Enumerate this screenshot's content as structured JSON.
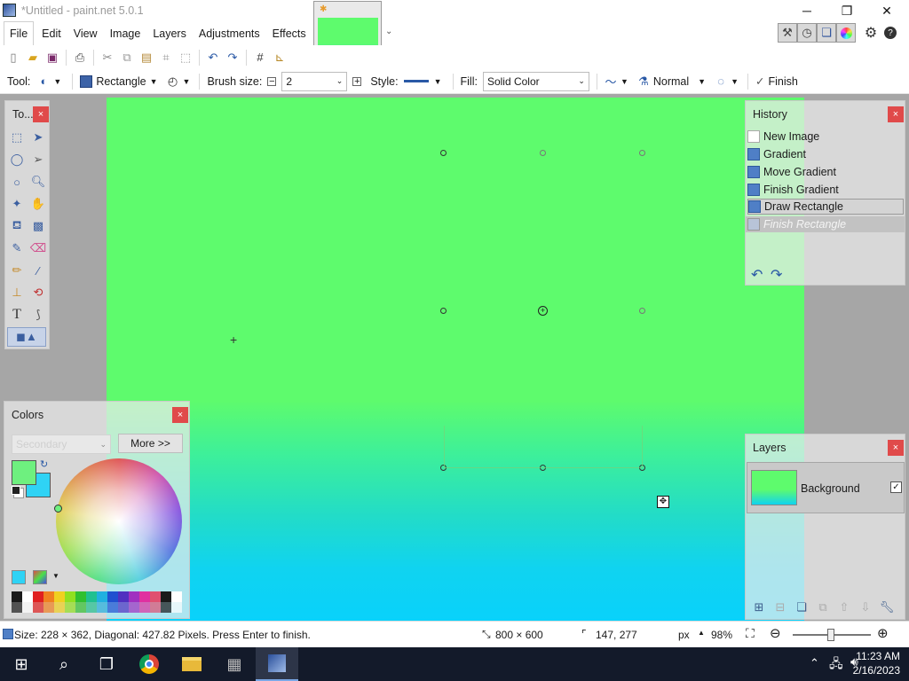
{
  "window": {
    "title": "*Untitled - paint.net 5.0.1",
    "minimize": "─",
    "restore": "❐",
    "close": "✕"
  },
  "menu": {
    "items": [
      "File",
      "Edit",
      "View",
      "Image",
      "Layers",
      "Adjustments",
      "Effects"
    ]
  },
  "image_tab": {
    "dirty_marker": "✱"
  },
  "toolbar": {
    "tool_label": "Tool:",
    "shape_type": "Rectangle",
    "brush_label": "Brush size:",
    "brush_value": "2",
    "style_label": "Style:",
    "fill_label": "Fill:",
    "fill_value": "Solid Color",
    "blend_value": "Normal",
    "finish_label": "Finish"
  },
  "tools_panel": {
    "title": "To..."
  },
  "history_panel": {
    "title": "History",
    "items": [
      "New Image",
      "Gradient",
      "Move Gradient",
      "Finish Gradient",
      "Draw Rectangle",
      "Finish Rectangle"
    ],
    "selected_index": 4
  },
  "colors_panel": {
    "title": "Colors",
    "secondary_value": "Secondary",
    "more_label": "More >>",
    "primary": "#6ef07f",
    "secondary": "#2fd3f5"
  },
  "layers_panel": {
    "title": "Layers",
    "layer_name": "Background"
  },
  "status": {
    "message": "Size: 228 × 362, Diagonal: 427.82 Pixels. Press Enter to finish.",
    "image_size": "800 × 600",
    "cursor": "147, 277",
    "unit": "px",
    "zoom": "98%"
  },
  "taskbar": {
    "time": "11:23 AM",
    "date": "2/16/2023"
  },
  "palette": [
    "#1a1a1a",
    "#ffffff",
    "#e02020",
    "#f08020",
    "#f0d020",
    "#90e020",
    "#30c030",
    "#20c090",
    "#20b0e0",
    "#2050d0",
    "#5030c0",
    "#a030c0",
    "#e030a0",
    "#e05070"
  ]
}
